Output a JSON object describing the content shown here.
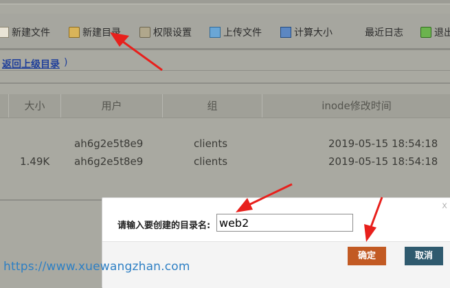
{
  "toolbar": {
    "items": [
      {
        "label": "新建文件"
      },
      {
        "label": "新建目录"
      },
      {
        "label": "权限设置"
      },
      {
        "label": "上传文件"
      },
      {
        "label": "计算大小"
      },
      {
        "label": "最近日志"
      },
      {
        "label": "退出"
      }
    ]
  },
  "path": {
    "back_label": "返回上级目录",
    "paren": ")"
  },
  "table": {
    "headers": [
      "大小",
      "用户",
      "组",
      "inode修改时间"
    ],
    "rows": [
      {
        "size": "",
        "user": "ah6g2e5t8e9",
        "group": "clients",
        "time": "2019-05-15 18:54:18"
      },
      {
        "size": "1.49K",
        "user": "ah6g2e5t8e9",
        "group": "clients",
        "time": "2019-05-15 18:54:18"
      }
    ]
  },
  "dialog": {
    "close": "x",
    "label": "请输入要创建的目录名:",
    "input_value": "web2",
    "ok_label": "确定",
    "cancel_label": "取消"
  },
  "watermark": "https://www.xuewangzhan.com",
  "colors": {
    "annotation_arrow": "#e8201c",
    "ok_button": "#c25a23",
    "cancel_button": "#2f5a6e"
  }
}
